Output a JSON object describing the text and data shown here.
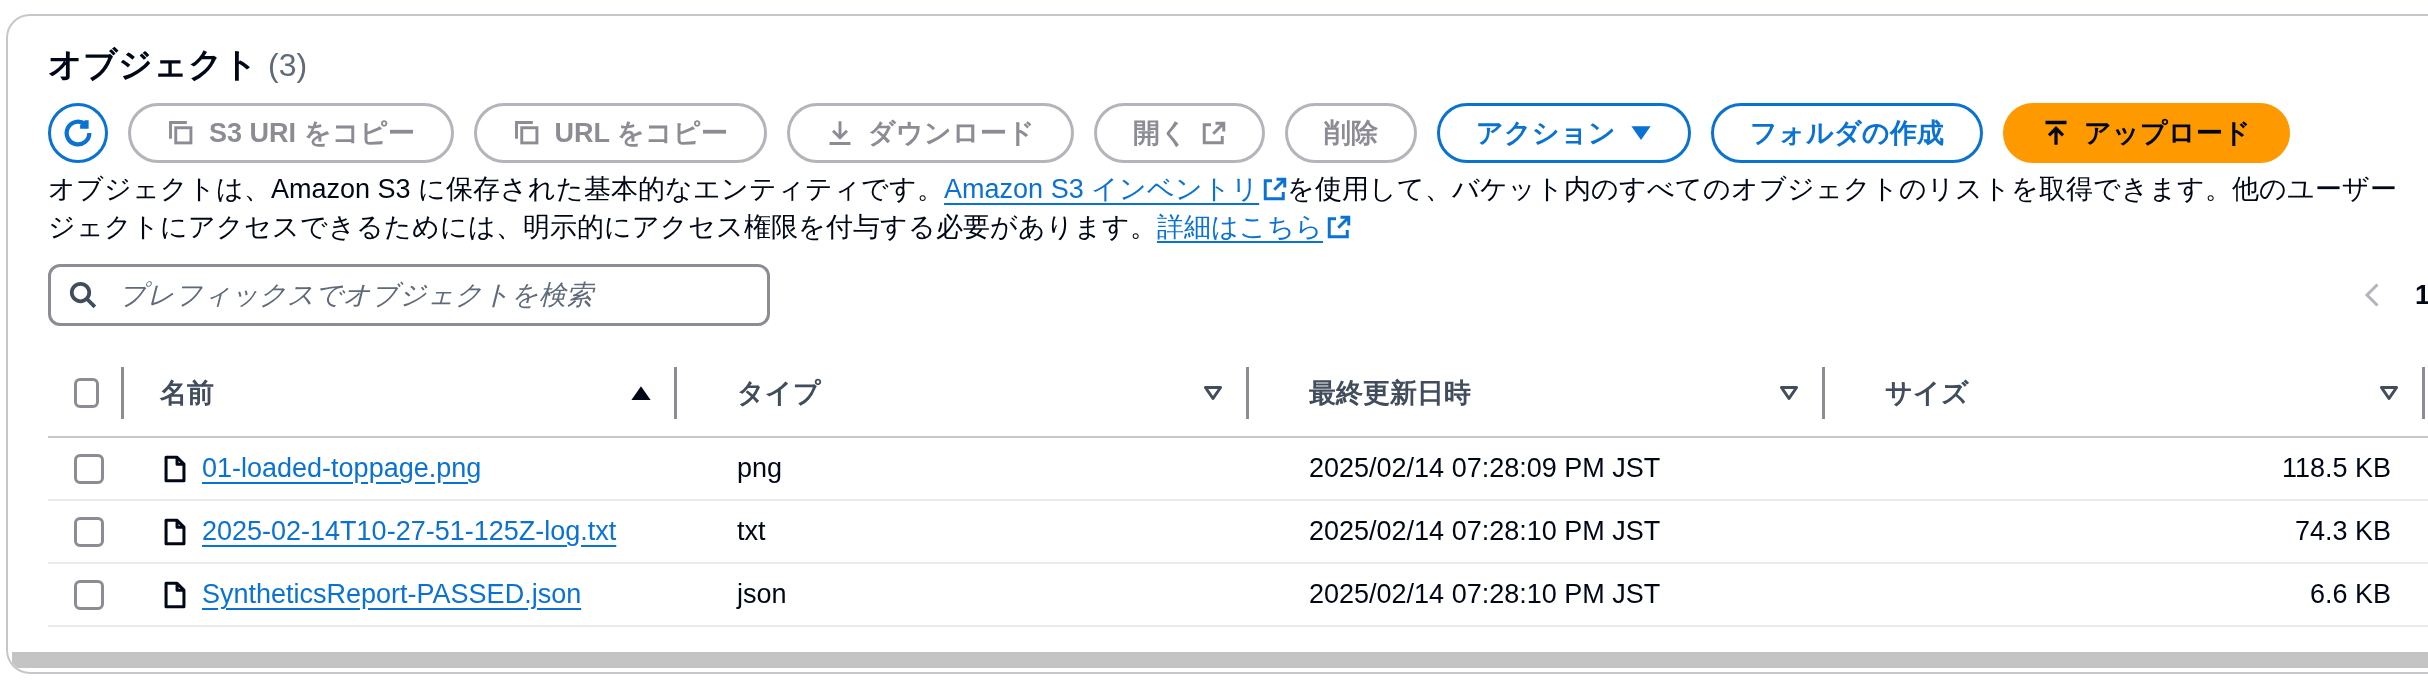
{
  "panel": {
    "title": "オブジェクト",
    "count": "(3)"
  },
  "toolbar": [
    {
      "kind": "refresh",
      "disabled": false
    },
    {
      "kind": "copy",
      "label": "S3 URI をコピー",
      "disabled": true
    },
    {
      "kind": "copy",
      "label": "URL をコピー",
      "disabled": true
    },
    {
      "kind": "download",
      "label": "ダウンロード",
      "disabled": true
    },
    {
      "kind": "open",
      "label": "開く",
      "disabled": true
    },
    {
      "kind": "plain",
      "label": "削除",
      "disabled": true
    },
    {
      "kind": "dropdown",
      "label": "アクション",
      "disabled": false
    },
    {
      "kind": "plain",
      "label": "フォルダの作成",
      "disabled": false
    },
    {
      "kind": "upload",
      "label": "アップロード",
      "disabled": false
    }
  ],
  "description": [
    {
      "before": "オブジェクトは、Amazon S3 に保存された基本的なエンティティです。",
      "link": "Amazon S3 インベントリ",
      "after": "を使用して、バケット内のすべてのオブジェクトのリストを取得できます。他のユーザー"
    },
    {
      "before": "ジェクトにアクセスできるためには、明示的にアクセス権限を付与する必要があります。",
      "link": "詳細はこちら"
    }
  ],
  "search": {
    "placeholder": "プレフィックスでオブジェクトを検索"
  },
  "pagination": {
    "prev_disabled": true,
    "current": "1"
  },
  "table": {
    "select_all_checked": false,
    "columns": [
      {
        "label": "名前",
        "sorted": true
      },
      {
        "label": "タイプ",
        "sorted": false
      },
      {
        "label": "最終更新日時",
        "sorted": false
      },
      {
        "label": "サイズ",
        "sorted": false
      }
    ],
    "rows": [
      {
        "checked": false,
        "name": "01-loaded-toppage.png",
        "type": "png",
        "modified": "2025/02/14 07:28:09 PM JST",
        "size": "118.5 KB"
      },
      {
        "checked": false,
        "name": "2025-02-14T10-27-51-125Z-log.txt",
        "type": "txt",
        "modified": "2025/02/14 07:28:10 PM JST",
        "size": "74.3 KB"
      },
      {
        "checked": false,
        "name": "SyntheticsReport-PASSED.json",
        "type": "json",
        "modified": "2025/02/14 07:28:10 PM JST",
        "size": "6.6 KB"
      }
    ]
  }
}
